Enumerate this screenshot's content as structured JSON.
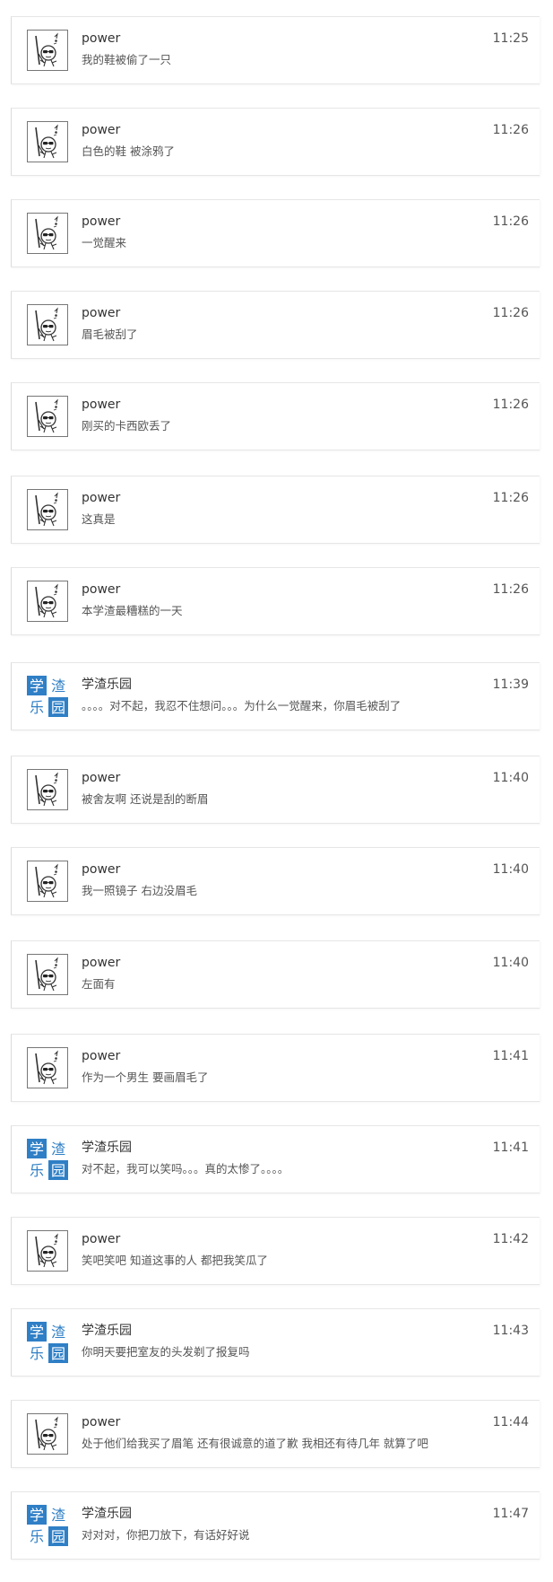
{
  "conversations": [
    {
      "sender": "power",
      "time": "11:25",
      "preview": "我的鞋被偷了一只",
      "avatar": "sunglasses-stickman-icon"
    },
    {
      "sender": "power",
      "time": "11:26",
      "preview": "白色的鞋 被涂鸦了",
      "avatar": "sunglasses-stickman-icon"
    },
    {
      "sender": "power",
      "time": "11:26",
      "preview": "一觉醒来",
      "avatar": "sunglasses-stickman-icon"
    },
    {
      "sender": "power",
      "time": "11:26",
      "preview": "眉毛被刮了",
      "avatar": "sunglasses-stickman-icon"
    },
    {
      "sender": "power",
      "time": "11:26",
      "preview": "刚买的卡西欧丢了",
      "avatar": "sunglasses-stickman-icon"
    },
    {
      "sender": "power",
      "time": "11:26",
      "preview": "这真是",
      "avatar": "sunglasses-stickman-icon"
    },
    {
      "sender": "power",
      "time": "11:26",
      "preview": "本学渣最糟糕的一天",
      "avatar": "sunglasses-stickman-icon"
    },
    {
      "sender": "学渣乐园",
      "time": "11:39",
      "preview": "。。。。对不起，我忍不住想问。。。为什么一觉醒来，你眉毛被刮了",
      "avatar": "xuezha-leyuan-logo"
    },
    {
      "sender": "power",
      "time": "11:40",
      "preview": "被舍友啊 还说是刮的断眉",
      "avatar": "sunglasses-stickman-icon"
    },
    {
      "sender": "power",
      "time": "11:40",
      "preview": "我一照镜子 右边没眉毛",
      "avatar": "sunglasses-stickman-icon"
    },
    {
      "sender": "power",
      "time": "11:40",
      "preview": "左面有",
      "avatar": "sunglasses-stickman-icon"
    },
    {
      "sender": "power",
      "time": "11:41",
      "preview": "作为一个男生 要画眉毛了",
      "avatar": "sunglasses-stickman-icon"
    },
    {
      "sender": "学渣乐园",
      "time": "11:41",
      "preview": "对不起，我可以笑吗。。。真的太惨了。。。。",
      "avatar": "xuezha-leyuan-logo"
    },
    {
      "sender": "power",
      "time": "11:42",
      "preview": "笑吧笑吧 知道这事的人 都把我笑瓜了",
      "avatar": "sunglasses-stickman-icon"
    },
    {
      "sender": "学渣乐园",
      "time": "11:43",
      "preview": "你明天要把室友的头发剃了报复吗",
      "avatar": "xuezha-leyuan-logo"
    },
    {
      "sender": "power",
      "time": "11:44",
      "preview": "处于他们给我买了眉笔 还有很诚意的道了歉 我相还有待几年 就算了吧",
      "avatar": "sunglasses-stickman-icon"
    },
    {
      "sender": "学渣乐园",
      "time": "11:47",
      "preview": "对对对，你把刀放下，有话好好说",
      "avatar": "xuezha-leyuan-logo"
    }
  ],
  "logo_text": [
    "学",
    "渣",
    "乐",
    "园"
  ],
  "colors": {
    "logo_blue": "#2f7fc6",
    "border": "#dcdcdc"
  }
}
